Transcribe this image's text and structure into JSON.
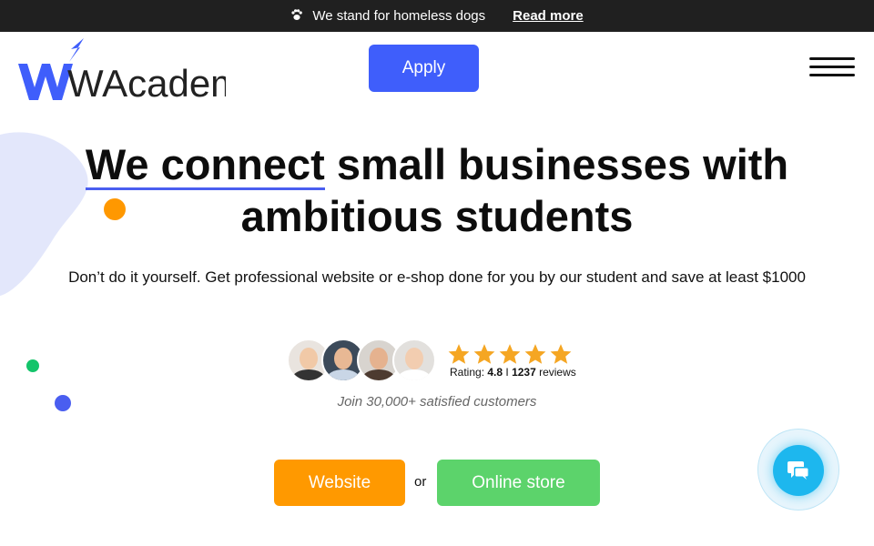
{
  "topbar": {
    "paw_icon": "paw-icon",
    "message": "We stand for homeless dogs",
    "link_label": "Read more"
  },
  "header": {
    "logo_text": "WAcademy",
    "apply_label": "Apply",
    "menu_icon": "hamburger-menu-icon"
  },
  "hero": {
    "headline_highlight": "We connect",
    "headline_rest": " small businesses with ambitious students",
    "subline": "Don’t do it yourself. Get professional website or e-shop done for you by our student and save at least $1000"
  },
  "proof": {
    "stars": 5,
    "rating_prefix": "Rating: ",
    "rating_value": "4.8",
    "rating_sep": " I ",
    "review_count": "1237",
    "reviews_suffix": " reviews",
    "join_text": "Join 30,000+ satisfied customers"
  },
  "cta": {
    "website_label": "Website",
    "or_label": "or",
    "store_label": "Online store"
  },
  "chat": {
    "icon": "chat-bubbles-icon"
  },
  "colors": {
    "brand_blue": "#3f5efb",
    "orange": "#ff9900",
    "green": "#5cd36b",
    "star": "#f5a623",
    "chat": "#1db7ee"
  }
}
